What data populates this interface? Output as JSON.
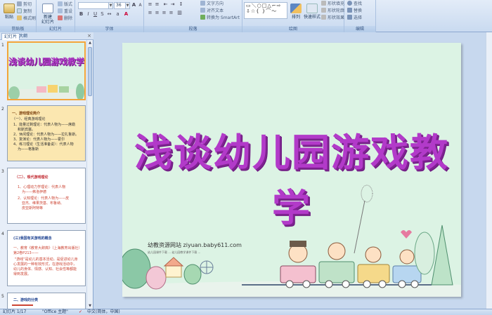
{
  "ribbon": {
    "clipboard": {
      "paste": "粘贴",
      "cut": "剪切",
      "copy": "复制",
      "format_painter": "格式刷",
      "label": "剪贴板"
    },
    "slides": {
      "new_slide": "新建",
      "new_slide2": "幻灯片",
      "layout": "版式",
      "reset": "重设",
      "delete": "删除",
      "label": "幻灯片"
    },
    "font": {
      "size": "36",
      "label": "字体"
    },
    "paragraph": {
      "text_direction": "文字方向",
      "align_text": "对齐文本",
      "smartart": "转换为 SmartArt",
      "label": "段落"
    },
    "drawing": {
      "arrange": "排列",
      "quick_styles": "快速样式",
      "shape_fill": "形状填充",
      "shape_outline": "形状轮廓",
      "shape_effects": "形状效果",
      "label": "绘图"
    },
    "editing": {
      "find": "查找",
      "replace": "替换",
      "select": "选择",
      "label": "编辑"
    }
  },
  "pane": {
    "tab_slides": "幻灯片",
    "tab_outline": "大纲",
    "close": "×",
    "thumbnails": [
      {
        "num": "1",
        "title": "浅谈幼儿园游戏教学"
      },
      {
        "num": "2",
        "lines": [
          "一、游戏理论简介",
          "（一）、经典游戏理论",
          "1、能量过剩理论：代表人物为——席勒",
          "和斯宾塞。",
          "2、休闲理论：代表人物为——拉扎鲁斯。",
          "3、复演论：代表人物为——霍尔",
          "4、练习理论（生活准备说）：代表人物",
          "为——格鲁斯"
        ]
      },
      {
        "num": "3",
        "lines": [
          "（二）、现代游戏理论",
          "1、心理动力学理论：代表人物",
          "为——弗洛伊德",
          "2、认知理论：代表人物为——皮",
          "亚杰、维果茨基、布鲁纳、",
          "皮亚斯阿特等"
        ]
      },
      {
        "num": "4",
        "lines": [
          "(三)我国有关游戏的概念",
          "一、教育《教育大辞典》（上海教育出版社）",
          "第2卷P213——",
          "\"游戏\"是幼儿的基本活动，是促进幼儿身",
          "心发展的一种有效形式，在游戏活动中，",
          "幼儿的身体、情感、认知、社会性等都能",
          "得到发展。"
        ]
      },
      {
        "num": "5",
        "lines": [
          "二、游戏的分类"
        ]
      }
    ]
  },
  "slide": {
    "title": "浅谈幼儿园游戏教学",
    "watermark": "幼教资源网站  ziyuan.baby611.com",
    "watermark_small": "幼儿园课件下载 ... 幼儿园教学课件下载 ..."
  },
  "status": {
    "slide_info": "幻灯片 1/17",
    "theme": "\"Office 主题\"",
    "language": "中文(简体，中国)"
  },
  "colors": {
    "title_purple": "#b23ac9",
    "slide_bg": "#dcf3e4",
    "selection": "#f3a53a"
  }
}
